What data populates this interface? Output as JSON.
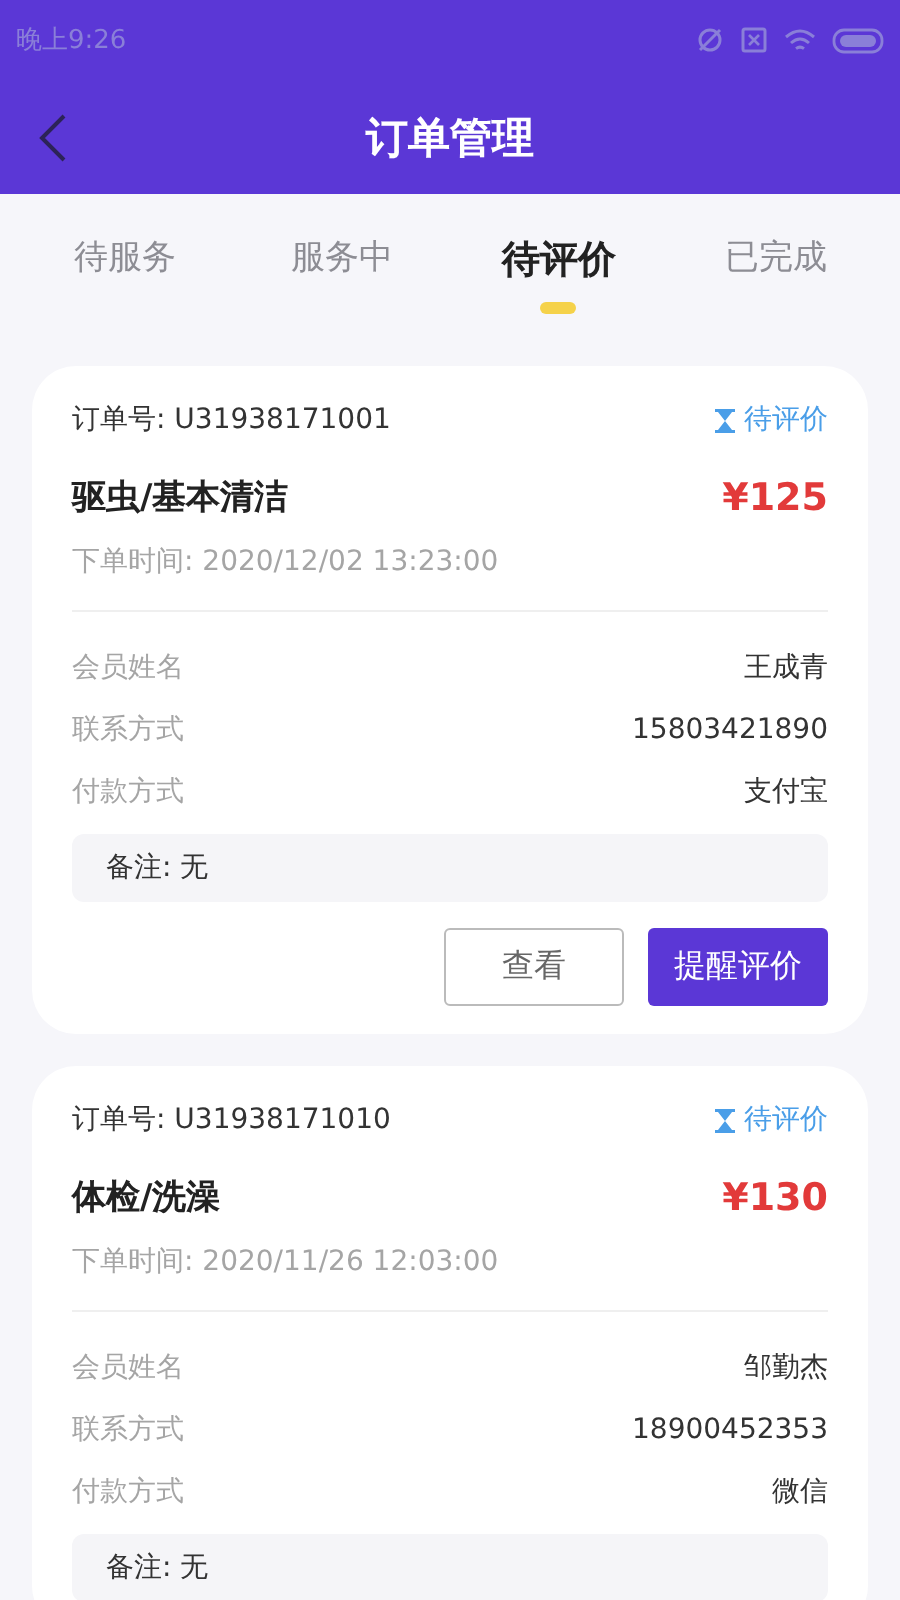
{
  "status_bar": {
    "time": "晚上9:26"
  },
  "header": {
    "title": "订单管理"
  },
  "tabs": [
    {
      "label": "待服务",
      "selected": false
    },
    {
      "label": "服务中",
      "selected": false
    },
    {
      "label": "待评价",
      "selected": true
    },
    {
      "label": "已完成",
      "selected": false
    }
  ],
  "orders": [
    {
      "order_no": "订单号: U31938171001",
      "status": "待评价",
      "service": "驱虫/基本清洁",
      "price": "¥125",
      "time": "下单时间: 2020/12/02 13:23:00",
      "fields": [
        {
          "label": "会员姓名",
          "value": "王成青"
        },
        {
          "label": "联系方式",
          "value": "15803421890"
        },
        {
          "label": "付款方式",
          "value": "支付宝"
        }
      ],
      "note": "备注: 无",
      "buttons": [
        {
          "label": "查看",
          "kind": "outline"
        },
        {
          "label": "提醒评价",
          "kind": "primary"
        }
      ]
    },
    {
      "order_no": "订单号: U31938171010",
      "status": "待评价",
      "service": "体检/洗澡",
      "price": "¥130",
      "time": "下单时间: 2020/11/26 12:03:00",
      "fields": [
        {
          "label": "会员姓名",
          "value": "邹勤杰"
        },
        {
          "label": "联系方式",
          "value": "18900452353"
        },
        {
          "label": "付款方式",
          "value": "微信"
        }
      ],
      "note": "备注: 无"
    }
  ]
}
